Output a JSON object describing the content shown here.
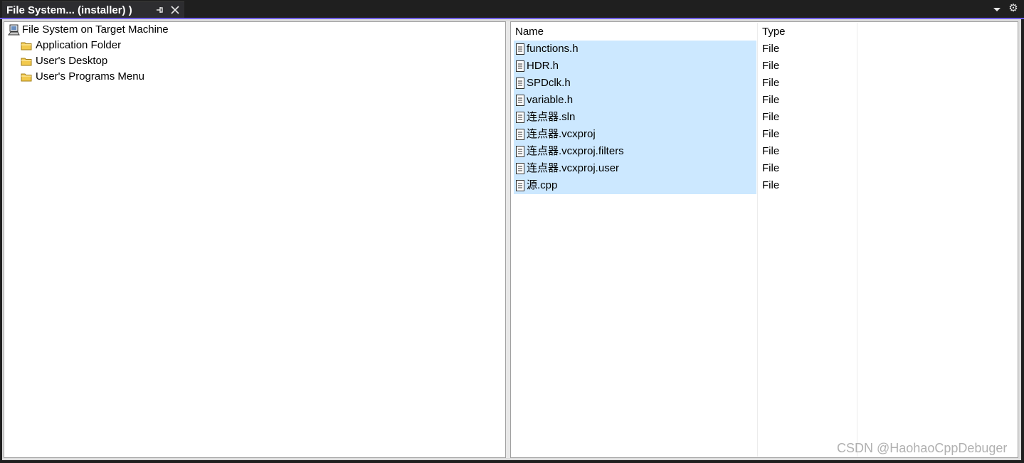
{
  "tab": {
    "title": "File System...  (installer) )"
  },
  "tree": {
    "root": "File System on Target Machine",
    "items": [
      {
        "label": "Application Folder"
      },
      {
        "label": "User's Desktop"
      },
      {
        "label": "User's Programs Menu"
      }
    ]
  },
  "list": {
    "columns": [
      "Name",
      "Type"
    ],
    "rows": [
      {
        "name": "functions.h",
        "type": "File"
      },
      {
        "name": "HDR.h",
        "type": "File"
      },
      {
        "name": "SPDclk.h",
        "type": "File"
      },
      {
        "name": "variable.h",
        "type": "File"
      },
      {
        "name": "连点器.sln",
        "type": "File"
      },
      {
        "name": "连点器.vcxproj",
        "type": "File"
      },
      {
        "name": "连点器.vcxproj.filters",
        "type": "File"
      },
      {
        "name": "连点器.vcxproj.user",
        "type": "File"
      },
      {
        "name": "源.cpp",
        "type": "File"
      }
    ]
  },
  "watermark": "CSDN @HaohaoCppDebuger",
  "colors": {
    "tab_accent": "#7160e8",
    "selection": "#cce8ff",
    "folder": "#f2c94c"
  },
  "icons": {
    "pin": "pin-icon",
    "close": "close-icon",
    "dropdown": "chevron-down-icon",
    "settings": "gear-icon",
    "computer": "computer-icon",
    "folder": "folder-icon",
    "file": "file-icon"
  }
}
